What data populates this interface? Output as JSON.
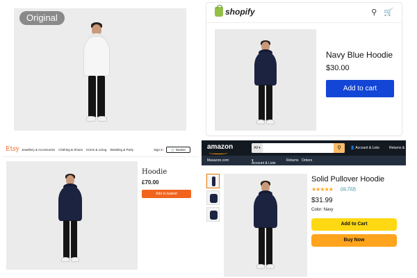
{
  "original": {
    "badge": "Original"
  },
  "shopify": {
    "logo": "shopify",
    "icons": [
      "search-icon",
      "cart-icon"
    ],
    "product_title": "Navy Blue Hoodie",
    "price": "$30.00",
    "add_to_cart": "Add to cart",
    "button_color": "#1345d6"
  },
  "etsy": {
    "logo": "Etsy",
    "categories": [
      "Jewellery & Accessories",
      "Clothing & Shoes",
      "Home & Living",
      "Wedding & Party"
    ],
    "sign_in": "Sign in",
    "basket": "Basket",
    "product_title": "Hoodie",
    "price": "£70.00",
    "add_to_basket": "Add to basket",
    "accent": "#f1641e"
  },
  "amazon": {
    "logo": "amazon",
    "search_category": "All",
    "account": "Account & Lists",
    "returns": "Returns &",
    "subnav": [
      "Masazon.com",
      "Account & Lists",
      "Returns",
      "Orders"
    ],
    "product_title": "Solid Pullover Hoodie",
    "stars": "★★★★★",
    "rating": 4.5,
    "reviews": "(11,722)",
    "price": "$31.99",
    "color_label": "Color: Navy",
    "add_to_cart": "Add to Cart",
    "buy_now": "Buy Now"
  }
}
